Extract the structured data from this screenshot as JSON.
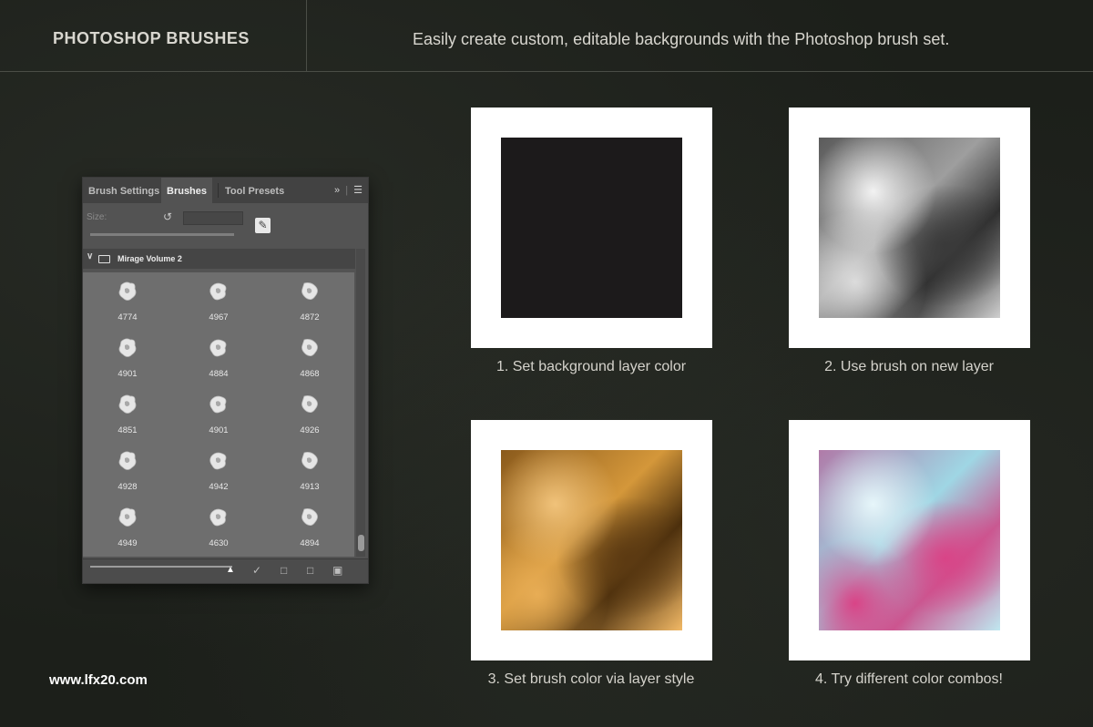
{
  "header": {
    "title": "PHOTOSHOP BRUSHES",
    "tagline": "Easily create custom, editable backgrounds with the Photoshop brush set."
  },
  "website": "www.lfx20.com",
  "panel": {
    "tabs": [
      {
        "label": "Brush Settings",
        "active": false
      },
      {
        "label": "Brushes",
        "active": true
      },
      {
        "label": "Tool Presets",
        "active": false
      }
    ],
    "overflow_icon": "double-chevron-right-icon",
    "menu_icon": "hamburger-icon",
    "size_label": "Size:",
    "reset_icon": "reset-icon",
    "new_brush_icon": "new-brush-icon",
    "group": {
      "name": "Mirage Volume 2",
      "expanded": true
    },
    "brushes": [
      "4774",
      "4967",
      "4872",
      "4901",
      "4884",
      "4868",
      "4851",
      "4901",
      "4926",
      "4928",
      "4942",
      "4913",
      "4949",
      "4630",
      "4894"
    ],
    "footer_icons": [
      "visibility-toggle-icon",
      "folder-icon",
      "new-page-icon",
      "trash-icon"
    ]
  },
  "steps": [
    {
      "caption": "1. Set background layer color",
      "swatch": "#1c1a1b"
    },
    {
      "caption": "2. Use brush on new layer",
      "swatch": "#9e9e9e"
    },
    {
      "caption": "3. Set brush color via layer style",
      "swatch": "#d4973a"
    },
    {
      "caption": "4. Try different color combos!",
      "swatch": "#9fd6e4",
      "accent": "#d94487"
    }
  ]
}
